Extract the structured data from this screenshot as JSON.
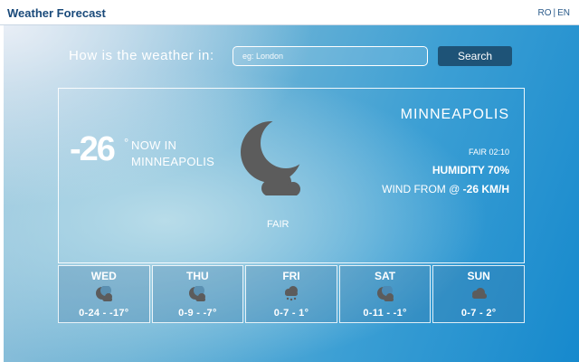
{
  "app": {
    "title": "Weather Forecast"
  },
  "lang": {
    "ro": "RO",
    "separator": "|",
    "en": "EN"
  },
  "search": {
    "label": "How is the weather in:",
    "placeholder": "eg: London",
    "value": "",
    "button_label": "Search"
  },
  "current": {
    "temperature": "-26",
    "degree_symbol": "°",
    "now_line1": "NOW IN",
    "now_line2": "MINNEAPOLIS",
    "icon": "moon-cloud-icon",
    "condition": "FAIR",
    "city": "MINNEAPOLIS",
    "observation": "FAIR 02:10",
    "humidity_label": "HUMIDITY",
    "humidity_value": "70%",
    "wind_label": "WIND FROM @",
    "wind_value": "-26 KM/H"
  },
  "forecast": [
    {
      "day": "WED",
      "range": "0-24 - -17°",
      "icon": "moon-cloud-icon"
    },
    {
      "day": "THU",
      "range": "0-9 - -7°",
      "icon": "moon-cloud-icon"
    },
    {
      "day": "FRI",
      "range": "0-7 - 1°",
      "icon": "snow-cloud-icon"
    },
    {
      "day": "SAT",
      "range": "0-11 - -1°",
      "icon": "moon-cloud-icon"
    },
    {
      "day": "SUN",
      "range": "0-7 - 2°",
      "icon": "cloud-icon"
    }
  ],
  "colors": {
    "title": "#1a4a7a",
    "search_button": "#1e5377",
    "icon_gray": "#5c5c5c"
  }
}
